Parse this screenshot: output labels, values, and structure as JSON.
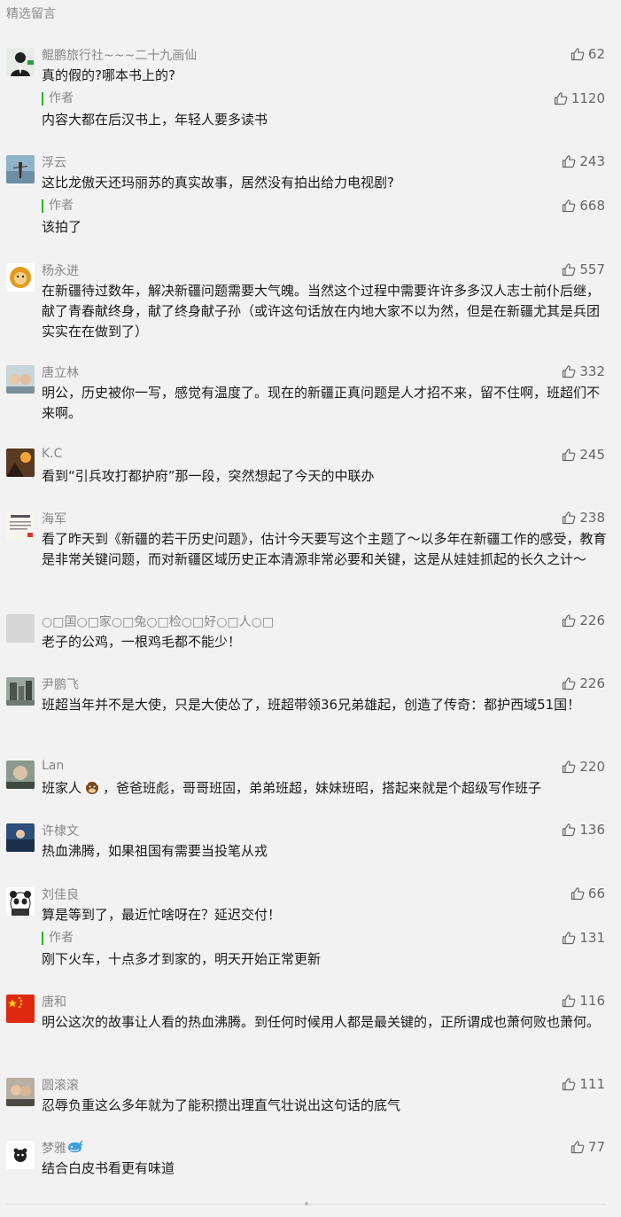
{
  "header": "精选留言",
  "comments": [
    {
      "nick": "鲲鹏旅行社~~~二十九画仙",
      "likes": "62",
      "text": "真的假的?哪本书上的?",
      "reply": {
        "label": "作者",
        "likes": "1120",
        "text": "内容大都在后汉书上，年轻人要多读书"
      }
    },
    {
      "nick": "浮云",
      "likes": "243",
      "text": "这比龙傲天还玛丽苏的真实故事，居然没有拍出给力电视剧?",
      "reply": {
        "label": "作者",
        "likes": "668",
        "text": "该拍了"
      }
    },
    {
      "nick": "杨永进",
      "likes": "557",
      "text": "在新疆待过数年，解决新疆问题需要大气魄。当然这个过程中需要许许多多汉人志士前仆后继，献了青春献终身，献了终身献子孙（或许这句话放在内地大家不以为然，但是在新疆尤其是兵团实实在在做到了）"
    },
    {
      "nick": "唐立林",
      "likes": "332",
      "text": "明公，历史被你一写，感觉有温度了。现在的新疆正真问题是人才招不来，留不住啊，班超们不来啊。"
    },
    {
      "nick": "K.C",
      "likes": "245",
      "text": "看到“引兵攻打都护府”那一段，突然想起了今天的中联办"
    },
    {
      "nick": "海军",
      "likes": "238",
      "text": "看了昨天到《新疆的若干历史问题》，估计今天要写这个主题了～以多年在新疆工作的感受，教育是非常关键问题，而对新疆区域历史正本清源非常必要和关键，这是从娃娃抓起的长久之计～"
    },
    {
      "nick": "○□国○□家○□兔○□检○□好○□人○□",
      "likes": "226",
      "text": "老子的公鸡，一根鸡毛都不能少！"
    },
    {
      "nick": "尹鹏飞",
      "likes": "226",
      "text": "班超当年并不是大使，只是大使怂了，班超带领36兄弟雄起，创造了传奇：都护西域51国！"
    },
    {
      "nick": "Lan",
      "likes": "220",
      "text_pre": "班家人",
      "text_post": "，爸爸班彪，哥哥班固，弟弟班超，妹妹班昭，搭起来就是个超级写作班子"
    },
    {
      "nick": "许棣文",
      "likes": "136",
      "text": "热血沸腾，如果祖国有需要当投笔从戎"
    },
    {
      "nick": "刘佳良",
      "likes": "66",
      "text": "算是等到了，最近忙啥呀在？延迟交付！",
      "reply": {
        "label": "作者",
        "likes": "131",
        "text": "刚下火车，十点多才到家的，明天开始正常更新"
      }
    },
    {
      "nick": "唐和",
      "likes": "116",
      "text": "明公这次的故事让人看的热血沸腾。到任何时候用人都是最关键的，正所谓成也萧何败也萧何。"
    },
    {
      "nick": "圆滚滚",
      "likes": "111",
      "text": "忍辱负重这么多年就为了能积攒出理直气壮说出这句话的底气"
    },
    {
      "nick": "梦雅",
      "likes": "77",
      "text": "结合白皮书看更有味道"
    }
  ],
  "colors": {
    "author_bar": "#2bad2b",
    "meta": "#888888",
    "text": "#1a1a1a",
    "bg": "#f2f2f2"
  }
}
